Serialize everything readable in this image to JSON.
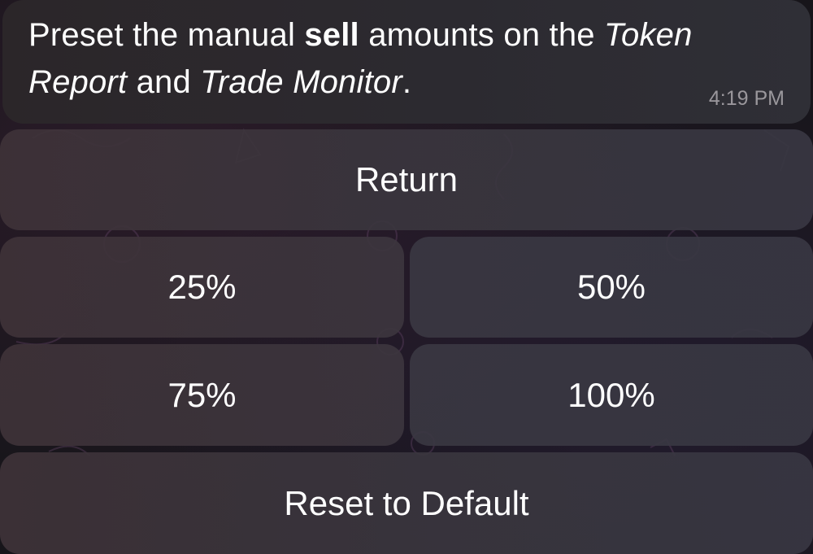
{
  "message": {
    "text_before": "Preset the manual ",
    "bold": "sell",
    "text_middle": " amounts on the ",
    "italic_1": "Token Report",
    "text_and": " and ",
    "italic_2": "Trade Monitor",
    "text_end": ".",
    "time": "4:19 PM"
  },
  "keyboard": {
    "return_label": "Return",
    "p25_label": "25%",
    "p50_label": "50%",
    "p75_label": "75%",
    "p100_label": "100%",
    "reset_label": "Reset to Default"
  }
}
